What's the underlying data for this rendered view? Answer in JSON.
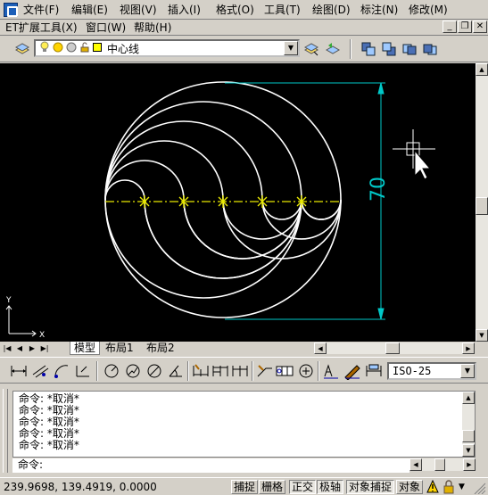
{
  "menubar": {
    "items": [
      {
        "label": "文件(F)"
      },
      {
        "label": "编辑(E)"
      },
      {
        "label": "视图(V)"
      },
      {
        "label": "插入(I)"
      },
      {
        "label": "格式(O)"
      },
      {
        "label": "工具(T)"
      },
      {
        "label": "绘图(D)"
      },
      {
        "label": "标注(N)"
      },
      {
        "label": "修改(M)"
      }
    ],
    "items2": [
      {
        "label": "ET扩展工具(X)"
      },
      {
        "label": "窗口(W)"
      },
      {
        "label": "帮助(H)"
      }
    ]
  },
  "layer_toolbar": {
    "layer_name": "中心线"
  },
  "drawing": {
    "dimension_text": "70",
    "ucs_x": "X",
    "ucs_y": "Y"
  },
  "tabs": {
    "items": [
      {
        "label": "模型"
      },
      {
        "label": "布局1"
      },
      {
        "label": "布局2"
      }
    ]
  },
  "dim_toolbar": {
    "dim_style": "ISO-25"
  },
  "command": {
    "history": [
      "命令: *取消*",
      "命令: *取消*",
      "命令: *取消*",
      "命令: *取消*",
      "命令: *取消*"
    ],
    "prompt": "命令:"
  },
  "statusbar": {
    "coords": "239.9698, 139.4919, 0.0000",
    "toggles": [
      {
        "label": "捕捉"
      },
      {
        "label": "栅格"
      },
      {
        "label": "正交"
      },
      {
        "label": "极轴"
      },
      {
        "label": "对象捕捉"
      },
      {
        "label": "对象"
      }
    ]
  },
  "colors": {
    "canvas": "#000000",
    "drawing_lines": "#ffffff",
    "dimension": "#00c8c8",
    "centerline": "#e8e800",
    "ui_face": "#d4d0c8"
  }
}
